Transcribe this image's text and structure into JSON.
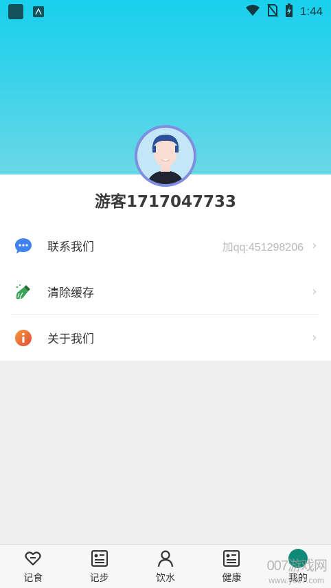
{
  "status_bar": {
    "time": "1:44"
  },
  "profile": {
    "username": "游客1717047733"
  },
  "menu": {
    "items": [
      {
        "label": "联系我们",
        "value": "加qq:451298206",
        "icon": "chat-bubble-icon"
      },
      {
        "label": "清除缓存",
        "value": "",
        "icon": "broom-icon"
      },
      {
        "label": "关于我们",
        "value": "",
        "icon": "info-icon"
      }
    ]
  },
  "tabbar": {
    "tabs": [
      {
        "label": "记食",
        "icon": "heart-icon"
      },
      {
        "label": "记步",
        "icon": "list-card-icon"
      },
      {
        "label": "饮水",
        "icon": "person-icon"
      },
      {
        "label": "健康",
        "icon": "list-card-icon"
      },
      {
        "label": "我的",
        "icon": "profile-dot-icon",
        "active": true
      }
    ]
  },
  "watermark": {
    "text": "007游戏网",
    "sub": "www.y007.com"
  },
  "colors": {
    "header_top": "#18d0ec",
    "header_bottom": "#6ad8e6",
    "active_tab": "#0f8a78",
    "avatar_ring": "#7e8fe0"
  }
}
